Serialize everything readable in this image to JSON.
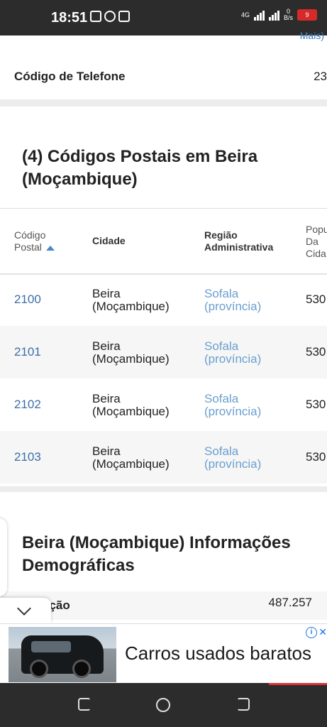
{
  "status_bar": {
    "time": "18:51",
    "network": "4G",
    "speed_value": "0",
    "speed_unit": "B/s",
    "battery": "9"
  },
  "phone": {
    "more_link": "Mais)",
    "label": "Código de Telefone",
    "value": "23"
  },
  "postal": {
    "heading": "(4) Códigos Postais em Beira (Moçambique)",
    "columns": {
      "code": "Código Postal",
      "city": "Cidade",
      "region": "Região Administrativa",
      "population": "Popu Da Cida"
    },
    "rows": [
      {
        "code": "2100",
        "city": "Beira (Moçambique)",
        "region": "Sofala (província)",
        "population": "530"
      },
      {
        "code": "2101",
        "city": "Beira (Moçambique)",
        "region": "Sofala (província)",
        "population": "530"
      },
      {
        "code": "2102",
        "city": "Beira (Moçambique)",
        "region": "Sofala (província)",
        "population": "530"
      },
      {
        "code": "2103",
        "city": "Beira (Moçambique)",
        "region": "Sofala (província)",
        "population": "530"
      }
    ]
  },
  "demographics": {
    "heading": "Beira (Moçambique) Informações Demográficas",
    "row_label": "ação",
    "row_value": "487.257"
  },
  "ad": {
    "text": "Carros usados baratos",
    "info_icon": "info-icon",
    "close_icon": "close-icon"
  },
  "colors": {
    "link": "#3b6ea5",
    "region_link": "#6a9fcf",
    "status_bar": "#2c2c2c",
    "battery_low": "#d62a2a"
  }
}
